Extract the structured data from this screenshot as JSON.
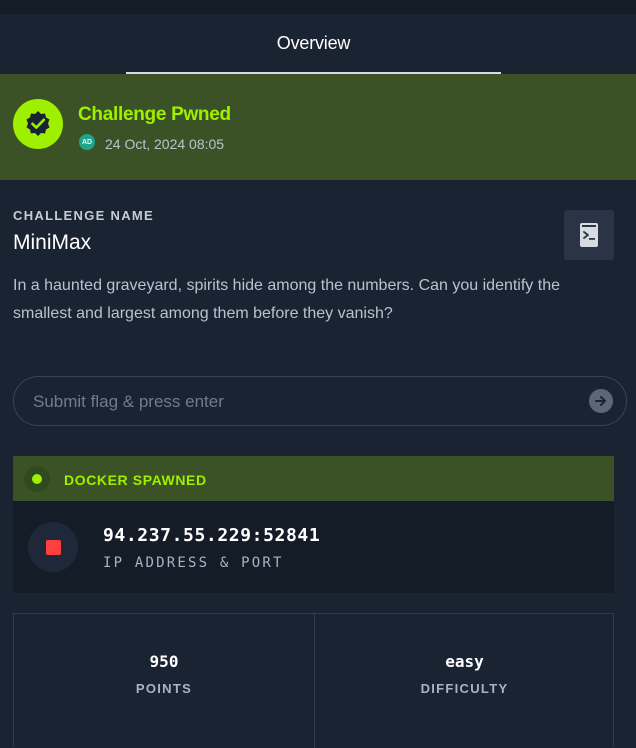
{
  "tabs": {
    "active_label": "Overview"
  },
  "status": {
    "title": "Challenge Pwned",
    "avatar_initials": "AD",
    "date": "24 Oct, 2024 08:05",
    "accent_color": "#9fef00"
  },
  "challenge": {
    "section_label": "CHALLENGE NAME",
    "name": "MiniMax",
    "description": "In a haunted graveyard, spirits hide among the numbers. Can you identify the smallest and largest among them before they vanish?"
  },
  "flag_input": {
    "placeholder": "Submit flag & press enter",
    "value": ""
  },
  "docker": {
    "status_label": "DOCKER SPAWNED",
    "address": "94.237.55.229:52841",
    "address_label": "IP ADDRESS & PORT",
    "stop_color": "#ff3e3e"
  },
  "stats": {
    "points_value": "950",
    "points_label": "POINTS",
    "difficulty_value": "easy",
    "difficulty_label": "DIFFICULTY"
  },
  "icons": {
    "badge": "verified-badge-icon",
    "terminal": "terminal-icon",
    "submit": "arrow-right-icon",
    "stop": "stop-icon"
  }
}
